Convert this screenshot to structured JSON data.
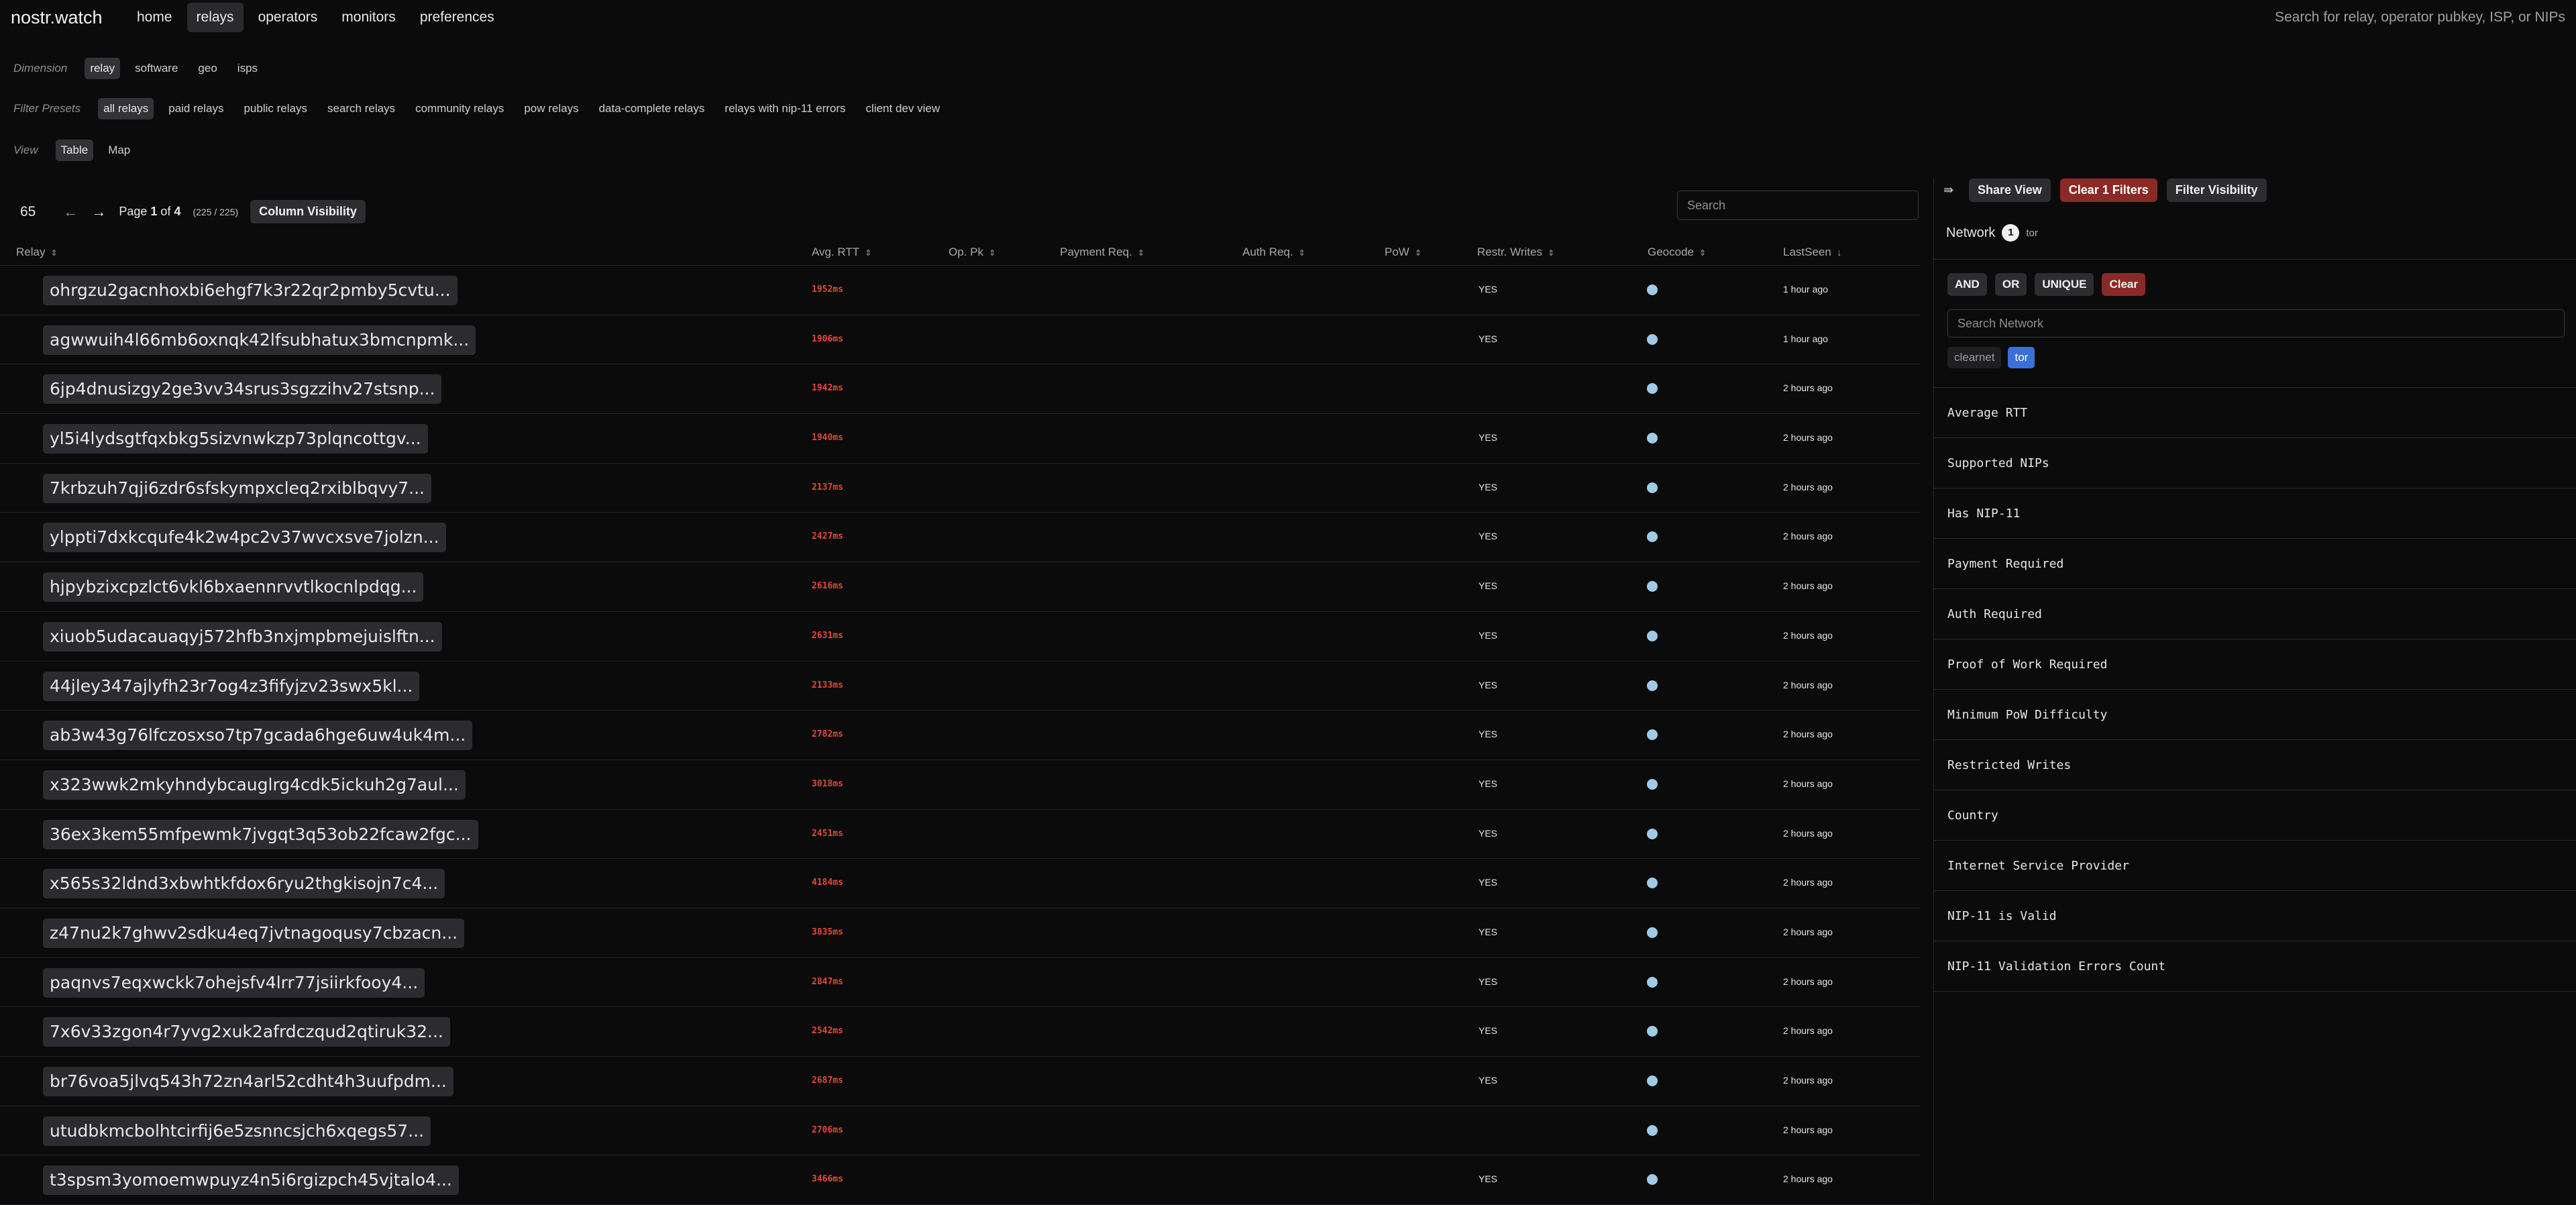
{
  "nav": {
    "brand": "nostr.watch",
    "items": [
      "home",
      "relays",
      "operators",
      "monitors",
      "preferences"
    ],
    "search_placeholder": "Search for relay, operator pubkey, ISP, or NIPs"
  },
  "dimension": {
    "label": "Dimension",
    "items": [
      "relay",
      "software",
      "geo",
      "isps"
    ]
  },
  "filter_presets": {
    "label": "Filter Presets",
    "items": [
      "all relays",
      "paid relays",
      "public relays",
      "search relays",
      "community relays",
      "pow relays",
      "data-complete relays",
      "relays with nip-11 errors",
      "client dev view"
    ]
  },
  "view": {
    "label": "View",
    "items": [
      "Table",
      "Map"
    ]
  },
  "table": {
    "count": "65",
    "page_prefix": "Page ",
    "page_current": "1",
    "page_of": " of ",
    "page_total": "4",
    "page_range": "(225 / 225)",
    "column_visibility": "Column Visibility",
    "search_placeholder": "Search",
    "columns": [
      "Relay",
      "Avg. RTT",
      "Op. Pk",
      "Payment Req.",
      "Auth Req.",
      "PoW",
      "Restr. Writes",
      "Geocode",
      "LastSeen"
    ],
    "rows": [
      {
        "relay": "ohrgzu2gacnhoxbi6ehgf7k3r22qr2pmby5cvtu...",
        "rtt": "1952ms",
        "restr": "YES",
        "seen": "1 hour ago"
      },
      {
        "relay": "agwwuih4l66mb6oxnqk42lfsubhatux3bmcnpmk...",
        "rtt": "1906ms",
        "restr": "YES",
        "seen": "1 hour ago"
      },
      {
        "relay": "6jp4dnusizgy2ge3vv34srus3sgzzihv27stsnp...",
        "rtt": "1942ms",
        "restr": "",
        "seen": "2 hours ago"
      },
      {
        "relay": "yl5i4lydsgtfqxbkg5sizvnwkzp73plqncottgv...",
        "rtt": "1940ms",
        "restr": "YES",
        "seen": "2 hours ago"
      },
      {
        "relay": "7krbzuh7qji6zdr6sfskympxcleq2rxiblbqvy7...",
        "rtt": "2137ms",
        "restr": "YES",
        "seen": "2 hours ago"
      },
      {
        "relay": "ylppti7dxkcqufe4k2w4pc2v37wvcxsve7jolzn...",
        "rtt": "2427ms",
        "restr": "YES",
        "seen": "2 hours ago"
      },
      {
        "relay": "hjpybzixcpzlct6vkl6bxaennrvvtlkocnlpdqg...",
        "rtt": "2616ms",
        "restr": "YES",
        "seen": "2 hours ago"
      },
      {
        "relay": "xiuob5udacauaqyj572hfb3nxjmpbmejuislftn...",
        "rtt": "2631ms",
        "restr": "YES",
        "seen": "2 hours ago"
      },
      {
        "relay": "44jley347ajlyfh23r7og4z3fifyjzv23swx5kl...",
        "rtt": "2133ms",
        "restr": "YES",
        "seen": "2 hours ago"
      },
      {
        "relay": "ab3w43g76lfczosxso7tp7gcada6hge6uw4uk4m...",
        "rtt": "2782ms",
        "restr": "YES",
        "seen": "2 hours ago"
      },
      {
        "relay": "x323wwk2mkyhndybcauglrg4cdk5ickuh2g7aul...",
        "rtt": "3018ms",
        "restr": "YES",
        "seen": "2 hours ago"
      },
      {
        "relay": "36ex3kem55mfpewmk7jvgqt3q53ob22fcaw2fgc...",
        "rtt": "2451ms",
        "restr": "YES",
        "seen": "2 hours ago"
      },
      {
        "relay": "x565s32ldnd3xbwhtkfdox6ryu2thgkisojn7c4...",
        "rtt": "4184ms",
        "restr": "YES",
        "seen": "2 hours ago"
      },
      {
        "relay": "z47nu2k7ghwv2sdku4eq7jvtnagoqusy7cbzacn...",
        "rtt": "3835ms",
        "restr": "YES",
        "seen": "2 hours ago"
      },
      {
        "relay": "paqnvs7eqxwckk7ohejsfv4lrr77jsiirkfooy4...",
        "rtt": "2847ms",
        "restr": "YES",
        "seen": "2 hours ago"
      },
      {
        "relay": "7x6v33zgon4r7yvg2xuk2afrdczqud2qtiruk32...",
        "rtt": "2542ms",
        "restr": "YES",
        "seen": "2 hours ago"
      },
      {
        "relay": "br76voa5jlvq543h72zn4arl52cdht4h3uufpdm...",
        "rtt": "2687ms",
        "restr": "YES",
        "seen": "2 hours ago"
      },
      {
        "relay": "utudbkmcbolhtcirfij6e5zsnncsjch6xqegs57...",
        "rtt": "2706ms",
        "restr": "",
        "seen": "2 hours ago"
      },
      {
        "relay": "t3spsm3yomoemwpuyz4n5i6rgizpch45vjtalo4...",
        "rtt": "3466ms",
        "restr": "YES",
        "seen": "2 hours ago"
      }
    ]
  },
  "panel": {
    "share_view": "Share View",
    "clear_filters": "Clear 1 Filters",
    "filter_visibility": "Filter Visibility",
    "network_label": "Network",
    "network_count": "1",
    "network_value": "tor",
    "logic": [
      "AND",
      "OR",
      "UNIQUE",
      "Clear"
    ],
    "network_search_placeholder": "Search Network",
    "network_options": [
      "clearnet",
      "tor"
    ],
    "facets": [
      "Average RTT",
      "Supported NIPs",
      "Has NIP-11",
      "Payment Required",
      "Auth Required",
      "Proof of Work Required",
      "Minimum PoW Difficulty",
      "Restricted Writes",
      "Country",
      "Internet Service Provider",
      "NIP-11 is Valid",
      "NIP-11 Validation Errors Count"
    ]
  },
  "colors": {
    "rtt": "#e5473a",
    "geo_dot": "#9fcbe6",
    "danger": "#8a2a26",
    "selected": "#3b6fd9"
  },
  "icons": {
    "sort": "sort-arrows-icon",
    "sort_desc": "arrow-down-icon",
    "prev": "arrow-left-icon",
    "next": "arrow-right-icon",
    "panel": "panel-toggle-icon"
  }
}
